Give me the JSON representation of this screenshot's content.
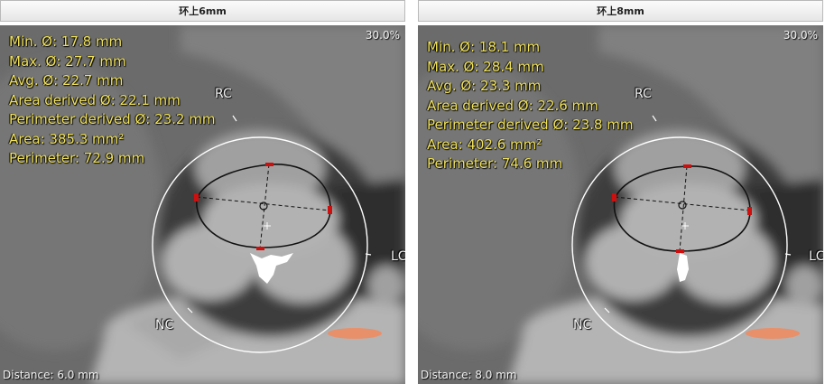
{
  "panels": [
    {
      "title": "环上6mm",
      "zoom": "30.0%",
      "distance": "Distance: 6.0 mm",
      "measurements": [
        "Min. Ø: 17.8 mm",
        "Max. Ø: 27.7 mm",
        "Avg. Ø: 22.7 mm",
        "Area derived Ø: 22.1 mm",
        "Perimeter derived Ø: 23.2 mm",
        "Area: 385.3 mm²",
        "Perimeter: 72.9 mm"
      ],
      "labels": {
        "rc": "RC",
        "nc": "NC",
        "lc": "LC"
      }
    },
    {
      "title": "环上8mm",
      "zoom": "30.0%",
      "distance": "Distance: 8.0 mm",
      "measurements": [
        "Min. Ø: 18.1 mm",
        "Max. Ø: 28.4 mm",
        "Avg. Ø: 23.3 mm",
        "Area derived Ø: 22.6 mm",
        "Perimeter derived Ø: 23.8 mm",
        "Area: 402.6 mm²",
        "Perimeter: 74.6 mm"
      ],
      "labels": {
        "rc": "RC",
        "nc": "NC",
        "lc": "LC"
      }
    }
  ],
  "colors": {
    "measurement_text": "#f1e25a",
    "contour": "#111111",
    "ring": "#ffffff",
    "marker": "#cc1010"
  }
}
